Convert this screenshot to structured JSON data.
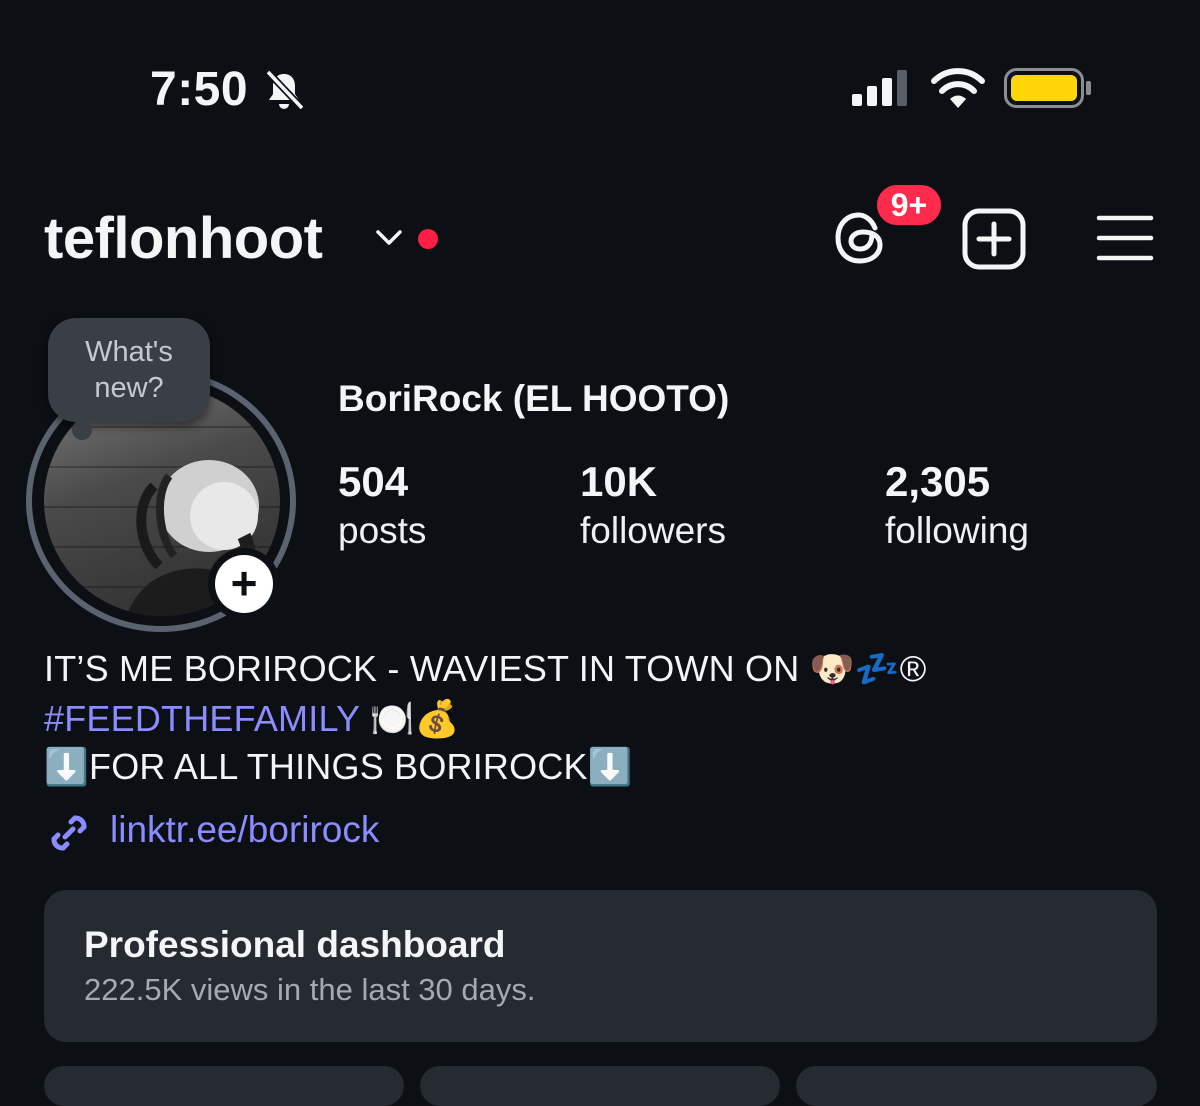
{
  "status_bar": {
    "time": "7:50",
    "icons": [
      "bell-slash-icon",
      "cellular-signal-icon",
      "wifi-icon",
      "battery-icon"
    ],
    "battery_color": "#ffd60a"
  },
  "header": {
    "username": "teflonhoot",
    "threads_badge": "9+",
    "icons": [
      "chevron-down-icon",
      "threads-icon",
      "create-plus-icon",
      "menu-icon"
    ],
    "live_dot_color": "#ff1e46"
  },
  "profile": {
    "note_bubble": {
      "line1": "What's",
      "line2": "new?"
    },
    "add_story_symbol": "+",
    "display_name": "BoriRock (EL HOOTO)",
    "stats": {
      "posts": {
        "value": "504",
        "label": "posts"
      },
      "followers": {
        "value": "10K",
        "label": "followers"
      },
      "following": {
        "value": "2,305",
        "label": "following"
      }
    },
    "bio": {
      "line1": "IT’S ME BORIROCK - WAVIEST IN TOWN ON 🐶💤®",
      "line2": "#FEEDTHEFAMILY 🍽️💰",
      "line3": "⬇️FOR ALL THINGS BORIROCK⬇️"
    },
    "link": "linktr.ee/borirock",
    "link_color": "#8b8cff"
  },
  "dashboard": {
    "title": "Professional dashboard",
    "subtitle": "222.5K views in the last 30 days."
  }
}
